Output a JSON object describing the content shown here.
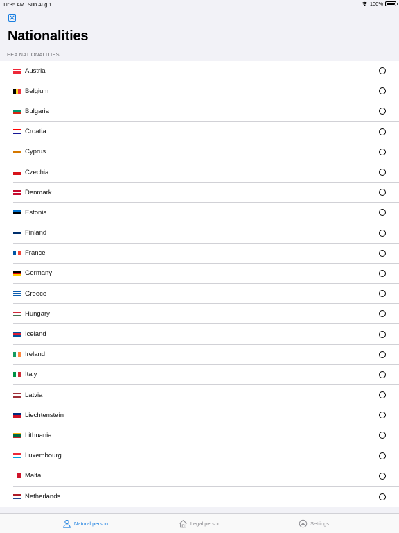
{
  "status": {
    "time": "11:35 AM",
    "date": "Sun Aug 1",
    "battery": "100%"
  },
  "header": {
    "title": "Nationalities"
  },
  "section": {
    "label": "EEA NATIONALITIES"
  },
  "countries": [
    {
      "name": "Austria",
      "flag": [
        "#ed2939",
        "#ffffff",
        "#ed2939"
      ],
      "dir": "h"
    },
    {
      "name": "Belgium",
      "flag": [
        "#000000",
        "#fdda24",
        "#ef3340"
      ],
      "dir": "v"
    },
    {
      "name": "Bulgaria",
      "flag": [
        "#ffffff",
        "#00966e",
        "#d62612"
      ],
      "dir": "h"
    },
    {
      "name": "Croatia",
      "flag": [
        "#ff0000",
        "#ffffff",
        "#171796"
      ],
      "dir": "h"
    },
    {
      "name": "Cyprus",
      "flag": [
        "#ffffff",
        "#d57800",
        "#ffffff"
      ],
      "dir": "h"
    },
    {
      "name": "Czechia",
      "flag": [
        "#ffffff",
        "#d7141a"
      ],
      "dir": "h"
    },
    {
      "name": "Denmark",
      "flag": [
        "#c60c30",
        "#ffffff",
        "#c60c30"
      ],
      "dir": "h"
    },
    {
      "name": "Estonia",
      "flag": [
        "#0072ce",
        "#000000",
        "#ffffff"
      ],
      "dir": "h"
    },
    {
      "name": "Finland",
      "flag": [
        "#ffffff",
        "#002f6c",
        "#ffffff"
      ],
      "dir": "h"
    },
    {
      "name": "France",
      "flag": [
        "#0055a4",
        "#ffffff",
        "#ef4135"
      ],
      "dir": "v"
    },
    {
      "name": "Germany",
      "flag": [
        "#000000",
        "#dd0000",
        "#ffce00"
      ],
      "dir": "h"
    },
    {
      "name": "Greece",
      "flag": [
        "#0d5eaf",
        "#ffffff",
        "#0d5eaf",
        "#ffffff",
        "#0d5eaf"
      ],
      "dir": "h"
    },
    {
      "name": "Hungary",
      "flag": [
        "#ce2939",
        "#ffffff",
        "#477050"
      ],
      "dir": "h"
    },
    {
      "name": "Iceland",
      "flag": [
        "#02529c",
        "#dc1e35",
        "#02529c"
      ],
      "dir": "h"
    },
    {
      "name": "Ireland",
      "flag": [
        "#169b62",
        "#ffffff",
        "#ff883e"
      ],
      "dir": "v"
    },
    {
      "name": "Italy",
      "flag": [
        "#009246",
        "#ffffff",
        "#ce2b37"
      ],
      "dir": "v"
    },
    {
      "name": "Latvia",
      "flag": [
        "#9e3039",
        "#ffffff",
        "#9e3039"
      ],
      "dir": "h"
    },
    {
      "name": "Liechtenstein",
      "flag": [
        "#002b7f",
        "#ce1126"
      ],
      "dir": "h"
    },
    {
      "name": "Lithuania",
      "flag": [
        "#fdb913",
        "#006a44",
        "#c1272d"
      ],
      "dir": "h"
    },
    {
      "name": "Luxembourg",
      "flag": [
        "#ed2939",
        "#ffffff",
        "#00a1de"
      ],
      "dir": "h"
    },
    {
      "name": "Malta",
      "flag": [
        "#ffffff",
        "#cf142b"
      ],
      "dir": "v"
    },
    {
      "name": "Netherlands",
      "flag": [
        "#ae1c28",
        "#ffffff",
        "#21468b"
      ],
      "dir": "h"
    }
  ],
  "tabs": {
    "natural": "Natural person",
    "legal": "Legal person",
    "settings": "Settings"
  },
  "colors": {
    "accent": "#1a7fe0",
    "inactive": "#8e8e93"
  },
  "icons": {
    "close": "close-icon",
    "natural": "person-icon",
    "legal": "house-icon",
    "settings": "gear-icon"
  }
}
